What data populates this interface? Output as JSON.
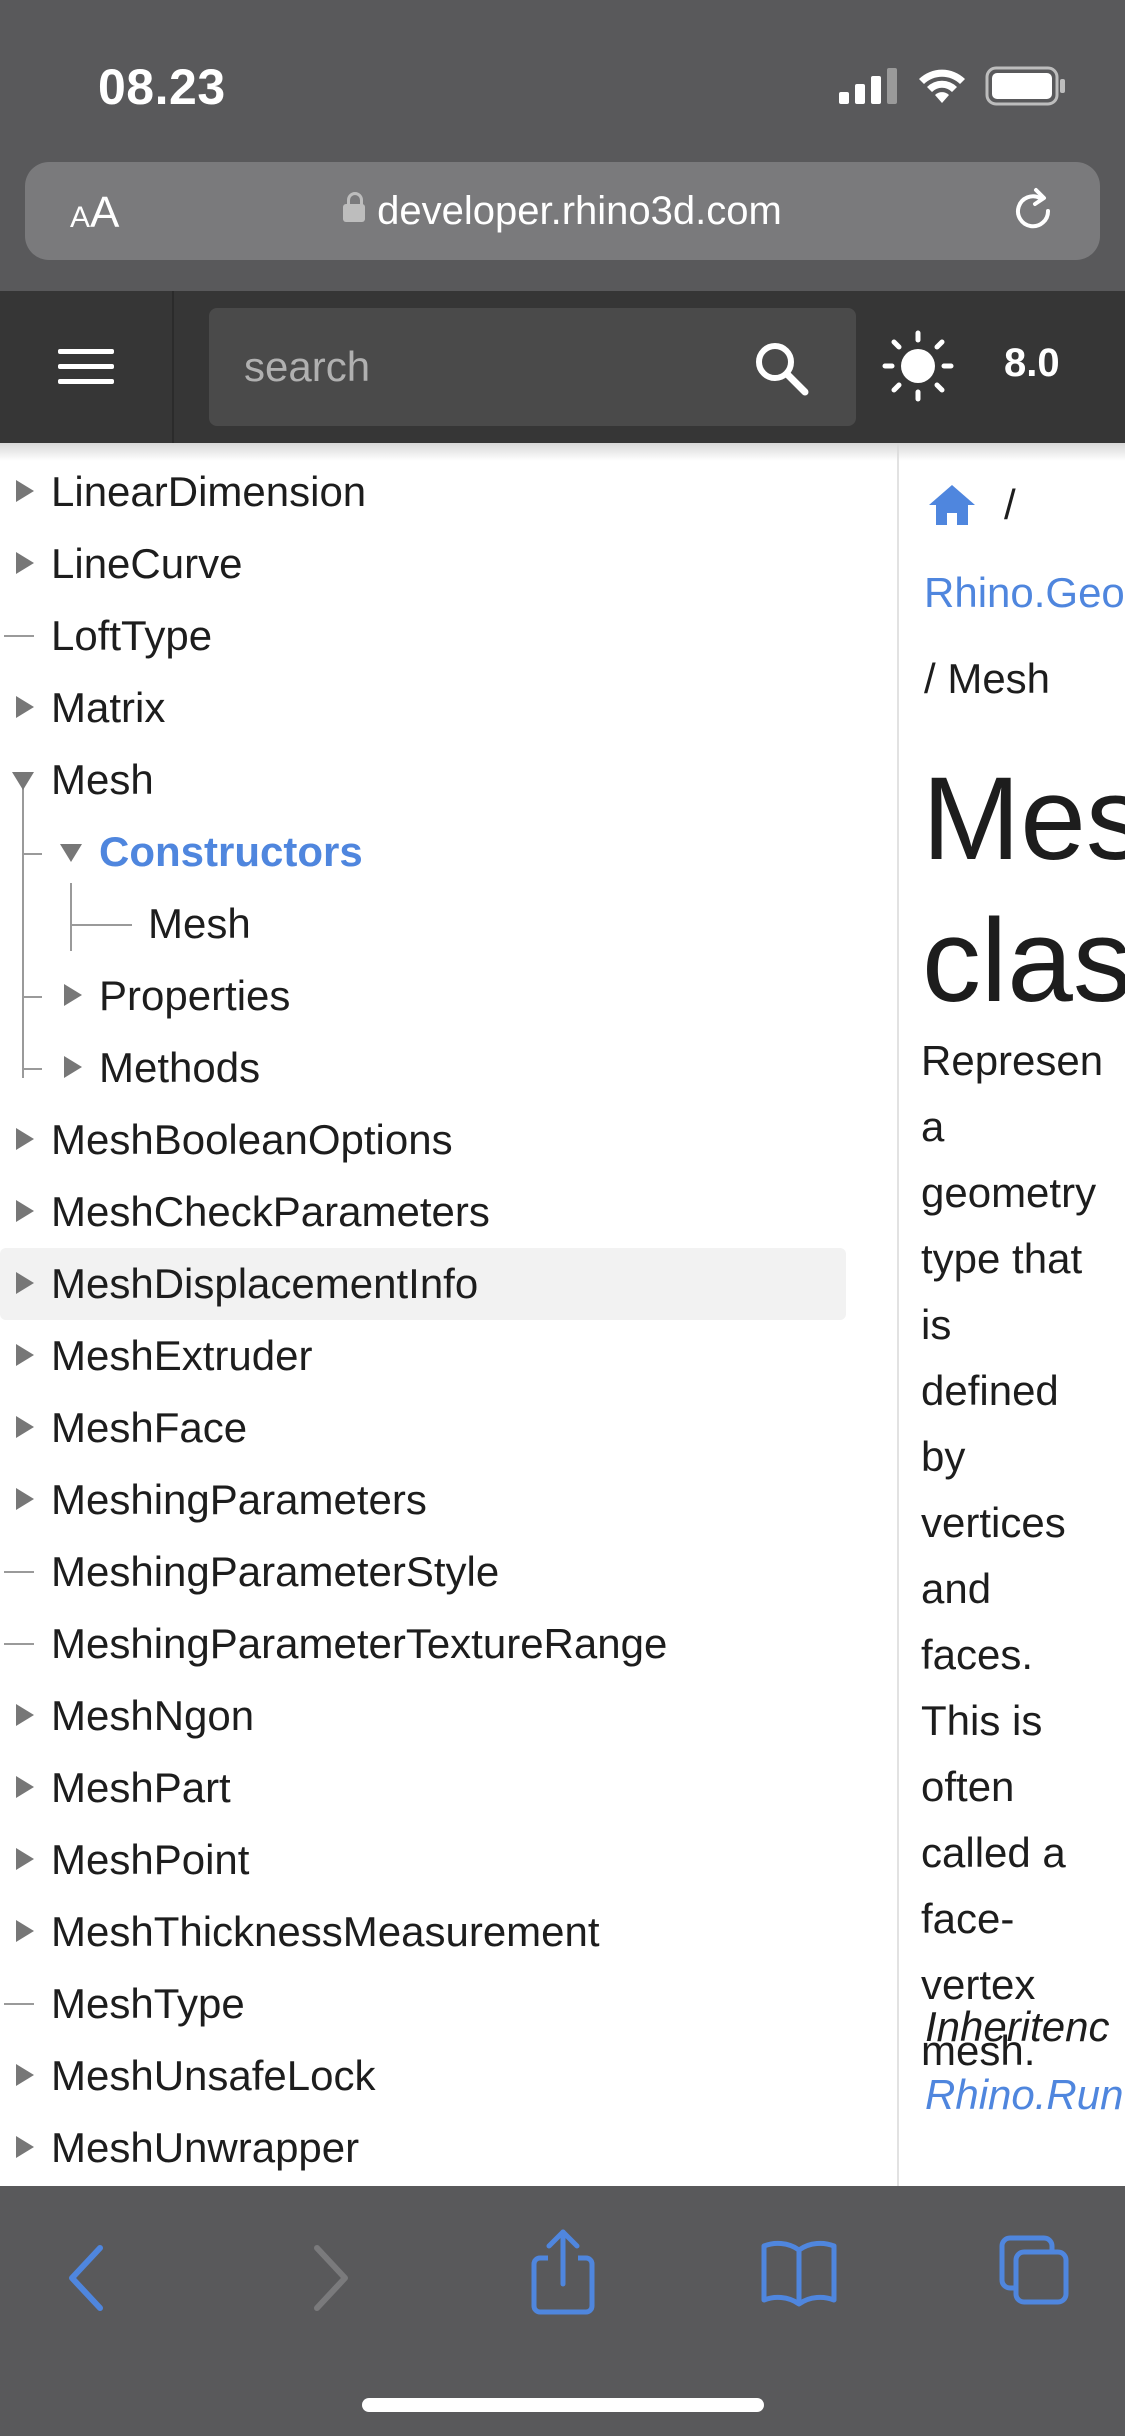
{
  "status_bar": {
    "time": "08.23"
  },
  "address_bar": {
    "text_size_label_small": "A",
    "text_size_label_big": "A",
    "url": "developer.rhino3d.com"
  },
  "site_header": {
    "search_placeholder": "search",
    "version": "8.0"
  },
  "tree": [
    {
      "label": "LinearDimension",
      "state": "collapsed"
    },
    {
      "label": "LineCurve",
      "state": "collapsed"
    },
    {
      "label": "LoftType",
      "state": "leaf"
    },
    {
      "label": "Matrix",
      "state": "collapsed"
    },
    {
      "label": "Mesh",
      "state": "expanded"
    },
    {
      "label": "Constructors",
      "state": "expanded",
      "active": true
    },
    {
      "label": "Mesh",
      "state": "leaf"
    },
    {
      "label": "Properties",
      "state": "collapsed"
    },
    {
      "label": "Methods",
      "state": "collapsed"
    },
    {
      "label": "MeshBooleanOptions",
      "state": "collapsed"
    },
    {
      "label": "MeshCheckParameters",
      "state": "collapsed"
    },
    {
      "label": "MeshDisplacementInfo",
      "state": "collapsed",
      "highlighted": true
    },
    {
      "label": "MeshExtruder",
      "state": "collapsed"
    },
    {
      "label": "MeshFace",
      "state": "collapsed"
    },
    {
      "label": "MeshingParameters",
      "state": "collapsed"
    },
    {
      "label": "MeshingParameterStyle",
      "state": "leaf"
    },
    {
      "label": "MeshingParameterTextureRange",
      "state": "leaf"
    },
    {
      "label": "MeshNgon",
      "state": "collapsed"
    },
    {
      "label": "MeshPart",
      "state": "collapsed"
    },
    {
      "label": "MeshPoint",
      "state": "collapsed"
    },
    {
      "label": "MeshThicknessMeasurement",
      "state": "collapsed"
    },
    {
      "label": "MeshType",
      "state": "leaf"
    },
    {
      "label": "MeshUnsafeLock",
      "state": "collapsed"
    },
    {
      "label": "MeshUnwrapper",
      "state": "collapsed"
    }
  ],
  "content": {
    "breadcrumb_sep": "/",
    "breadcrumb_namespace": "Rhino.Geo",
    "breadcrumb_current": "/  Mesh",
    "title_line1": "Mes",
    "title_line2": "clas",
    "description_lines": [
      "Represen",
      "a",
      "geometry",
      "type that",
      "is",
      "defined",
      "by",
      "vertices",
      "and",
      "faces.",
      "This is",
      "often",
      "called a",
      "face-",
      "vertex",
      "mesh."
    ],
    "inheritance_label": "Inheritenc",
    "inheritance_link": "Rhino.Run"
  },
  "colors": {
    "accent": "#4f86de",
    "header_bg": "#363636",
    "browser_chrome": "#59595b"
  },
  "toolbar": {
    "back_icon": "chevron-left-icon",
    "forward_icon": "chevron-right-icon",
    "share_icon": "share-icon",
    "bookmarks_icon": "book-icon",
    "tabs_icon": "tabs-icon"
  }
}
